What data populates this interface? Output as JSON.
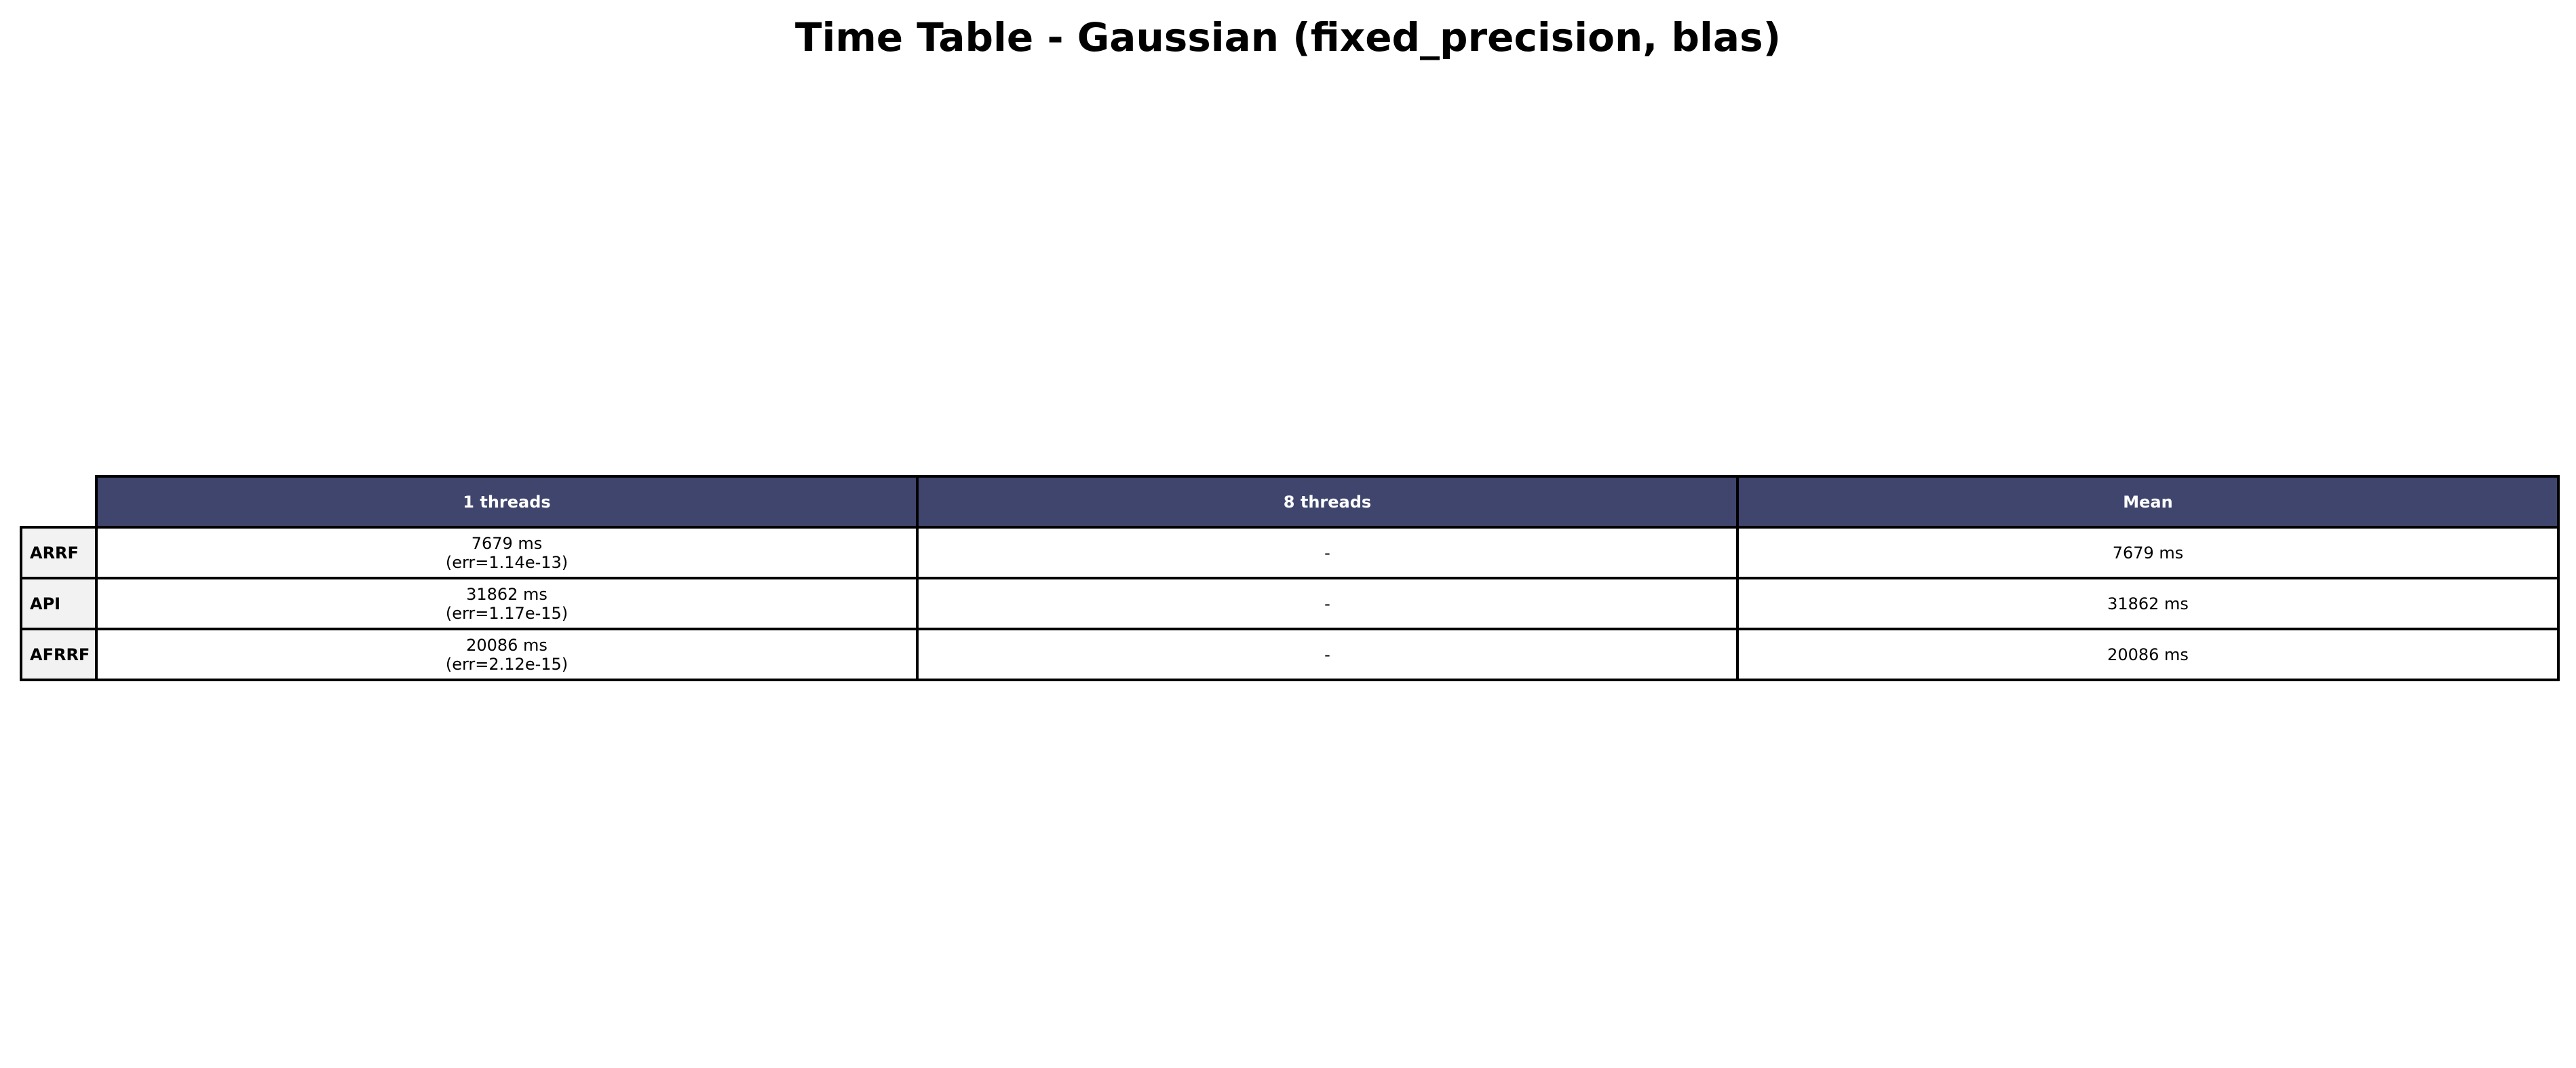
{
  "chart_data": {
    "type": "table",
    "title": "Time Table - Gaussian (fixed_precision, blas)",
    "columns": [
      "1 threads",
      "8 threads",
      "Mean"
    ],
    "rows": [
      {
        "label": "ARRF",
        "cells": [
          {
            "value": "7679 ms",
            "note": "(err=1.14e-13)"
          },
          {
            "value": "-",
            "note": ""
          },
          {
            "value": "7679 ms",
            "note": ""
          }
        ]
      },
      {
        "label": "API",
        "cells": [
          {
            "value": "31862 ms",
            "note": "(err=1.17e-15)"
          },
          {
            "value": "-",
            "note": ""
          },
          {
            "value": "31862 ms",
            "note": ""
          }
        ]
      },
      {
        "label": "AFRRF",
        "cells": [
          {
            "value": "20086 ms",
            "note": "(err=2.12e-15)"
          },
          {
            "value": "-",
            "note": ""
          },
          {
            "value": "20086 ms",
            "note": ""
          }
        ]
      }
    ],
    "colors": {
      "header_background": "#3f456d",
      "header_text": "#ffffff",
      "row_header_background": "#f2f2f2",
      "cell_background": "#ffffff",
      "border": "#000000"
    }
  }
}
